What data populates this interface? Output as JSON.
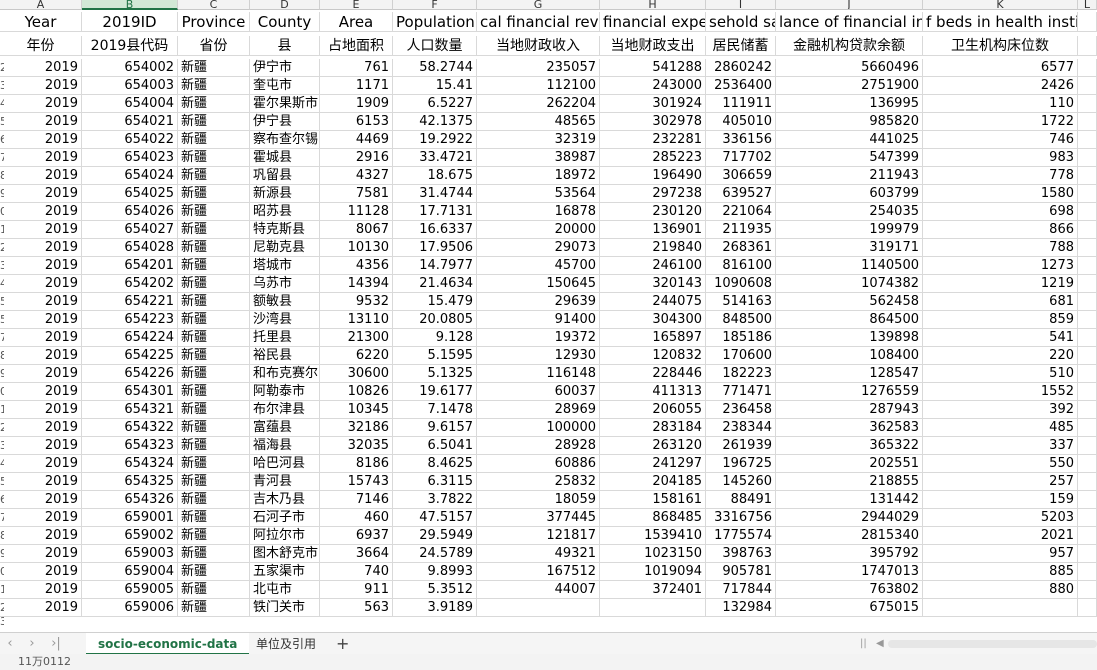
{
  "columns": [
    {
      "letter": "A",
      "header1": "Year",
      "header2": "年份",
      "align": "num"
    },
    {
      "letter": "B",
      "header1": "2019ID",
      "header2": "2019县代码",
      "align": "num"
    },
    {
      "letter": "C",
      "header1": "Province",
      "header2": "省份",
      "align": "txt"
    },
    {
      "letter": "D",
      "header1": "County",
      "header2": "县",
      "align": "txt"
    },
    {
      "letter": "E",
      "header1": "Area",
      "header2": "占地面积",
      "align": "num"
    },
    {
      "letter": "F",
      "header1": "Population",
      "header2": "人口数量",
      "align": "num"
    },
    {
      "letter": "G",
      "header1": "cal financial rever",
      "header2": "当地财政收入",
      "align": "num"
    },
    {
      "letter": "H",
      "header1": "financial expen",
      "header2": "当地财政支出",
      "align": "num"
    },
    {
      "letter": "I",
      "header1": "sehold sa",
      "header2": "居民储蓄",
      "align": "num"
    },
    {
      "letter": "J",
      "header1": "lance of financial ins",
      "header2": "金融机构贷款余额",
      "align": "num"
    },
    {
      "letter": "K",
      "header1": "f beds in health instituti",
      "header2": "卫生机构床位数",
      "align": "num"
    },
    {
      "letter": "L",
      "header1": "",
      "header2": "",
      "align": "num"
    }
  ],
  "selected_column": "B",
  "row_numbers": [
    "2",
    "3",
    "4",
    "5",
    "6",
    "7",
    "8",
    "9",
    "0",
    "1",
    "2",
    "3",
    "4",
    "5",
    "5",
    "7",
    "8",
    "9",
    "0",
    "1",
    "2",
    "3",
    "4",
    "5",
    "6",
    "7",
    "8",
    "9",
    "0",
    "1",
    "2",
    "3"
  ],
  "rows": [
    [
      "2019",
      "654002",
      "新疆",
      "伊宁市",
      "761",
      "58.2744",
      "235057",
      "541288",
      "2860242",
      "5660496",
      "6577"
    ],
    [
      "2019",
      "654003",
      "新疆",
      "奎屯市",
      "1171",
      "15.41",
      "112100",
      "243000",
      "2536400",
      "2751900",
      "2426"
    ],
    [
      "2019",
      "654004",
      "新疆",
      "霍尔果斯市",
      "1909",
      "6.5227",
      "262204",
      "301924",
      "111911",
      "136995",
      "110"
    ],
    [
      "2019",
      "654021",
      "新疆",
      "伊宁县",
      "6153",
      "42.1375",
      "48565",
      "302978",
      "405010",
      "985820",
      "1722"
    ],
    [
      "2019",
      "654022",
      "新疆",
      "察布查尔锡",
      "4469",
      "19.2922",
      "32319",
      "232281",
      "336156",
      "441025",
      "746"
    ],
    [
      "2019",
      "654023",
      "新疆",
      "霍城县",
      "2916",
      "33.4721",
      "38987",
      "285223",
      "717702",
      "547399",
      "983"
    ],
    [
      "2019",
      "654024",
      "新疆",
      "巩留县",
      "4327",
      "18.675",
      "18972",
      "196490",
      "306659",
      "211943",
      "778"
    ],
    [
      "2019",
      "654025",
      "新疆",
      "新源县",
      "7581",
      "31.4744",
      "53564",
      "297238",
      "639527",
      "603799",
      "1580"
    ],
    [
      "2019",
      "654026",
      "新疆",
      "昭苏县",
      "11128",
      "17.7131",
      "16878",
      "230120",
      "221064",
      "254035",
      "698"
    ],
    [
      "2019",
      "654027",
      "新疆",
      "特克斯县",
      "8067",
      "16.6337",
      "20000",
      "136901",
      "211935",
      "199979",
      "866"
    ],
    [
      "2019",
      "654028",
      "新疆",
      "尼勒克县",
      "10130",
      "17.9506",
      "29073",
      "219840",
      "268361",
      "319171",
      "788"
    ],
    [
      "2019",
      "654201",
      "新疆",
      "塔城市",
      "4356",
      "14.7977",
      "45700",
      "246100",
      "816100",
      "1140500",
      "1273"
    ],
    [
      "2019",
      "654202",
      "新疆",
      "乌苏市",
      "14394",
      "21.4634",
      "150645",
      "320143",
      "1090608",
      "1074382",
      "1219"
    ],
    [
      "2019",
      "654221",
      "新疆",
      "额敏县",
      "9532",
      "15.479",
      "29639",
      "244075",
      "514163",
      "562458",
      "681"
    ],
    [
      "2019",
      "654223",
      "新疆",
      "沙湾县",
      "13110",
      "20.0805",
      "91400",
      "304300",
      "848500",
      "864500",
      "859"
    ],
    [
      "2019",
      "654224",
      "新疆",
      "托里县",
      "21300",
      "9.128",
      "19372",
      "165897",
      "185186",
      "139898",
      "541"
    ],
    [
      "2019",
      "654225",
      "新疆",
      "裕民县",
      "6220",
      "5.1595",
      "12930",
      "120832",
      "170600",
      "108400",
      "220"
    ],
    [
      "2019",
      "654226",
      "新疆",
      "和布克赛尔",
      "30600",
      "5.1325",
      "116148",
      "228446",
      "182223",
      "128547",
      "510"
    ],
    [
      "2019",
      "654301",
      "新疆",
      "阿勒泰市",
      "10826",
      "19.6177",
      "60037",
      "411313",
      "771471",
      "1276559",
      "1552"
    ],
    [
      "2019",
      "654321",
      "新疆",
      "布尔津县",
      "10345",
      "7.1478",
      "28969",
      "206055",
      "236458",
      "287943",
      "392"
    ],
    [
      "2019",
      "654322",
      "新疆",
      "富蕴县",
      "32186",
      "9.6157",
      "100000",
      "283184",
      "238344",
      "362583",
      "485"
    ],
    [
      "2019",
      "654323",
      "新疆",
      "福海县",
      "32035",
      "6.5041",
      "28928",
      "263120",
      "261939",
      "365322",
      "337"
    ],
    [
      "2019",
      "654324",
      "新疆",
      "哈巴河县",
      "8186",
      "8.4625",
      "60886",
      "241297",
      "196725",
      "202551",
      "550"
    ],
    [
      "2019",
      "654325",
      "新疆",
      "青河县",
      "15743",
      "6.3115",
      "25832",
      "204185",
      "145260",
      "218855",
      "257"
    ],
    [
      "2019",
      "654326",
      "新疆",
      "吉木乃县",
      "7146",
      "3.7822",
      "18059",
      "158161",
      "88491",
      "131442",
      "159"
    ],
    [
      "2019",
      "659001",
      "新疆",
      "石河子市",
      "460",
      "47.5157",
      "377445",
      "868485",
      "3316756",
      "2944029",
      "5203"
    ],
    [
      "2019",
      "659002",
      "新疆",
      "阿拉尔市",
      "6937",
      "29.5949",
      "121817",
      "1539410",
      "1775574",
      "2815340",
      "2021"
    ],
    [
      "2019",
      "659003",
      "新疆",
      "图木舒克市",
      "3664",
      "24.5789",
      "49321",
      "1023150",
      "398763",
      "395792",
      "957"
    ],
    [
      "2019",
      "659004",
      "新疆",
      "五家渠市",
      "740",
      "9.8993",
      "167512",
      "1019094",
      "905781",
      "1747013",
      "885"
    ],
    [
      "2019",
      "659005",
      "新疆",
      "北屯市",
      "911",
      "5.3512",
      "44007",
      "372401",
      "717844",
      "763802",
      "880"
    ],
    [
      "2019",
      "659006",
      "新疆",
      "铁门关市",
      "563",
      "3.9189",
      "",
      "",
      "132984",
      "675015",
      ""
    ]
  ],
  "tabs": [
    {
      "label": "socio-economic-data",
      "active": true
    },
    {
      "label": "单位及引用",
      "active": false
    }
  ],
  "add_tab_label": "+",
  "status_text": "11万0112"
}
